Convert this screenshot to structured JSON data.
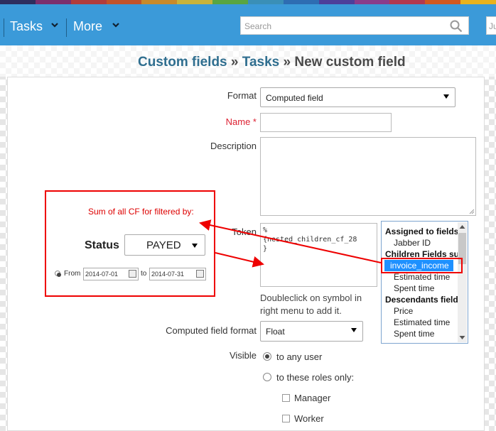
{
  "topstrip": {
    "colors": [
      "#2e2e5e",
      "#7b2f6d",
      "#b13c3c",
      "#c2532a",
      "#c98a2a",
      "#c9b33a",
      "#59a541",
      "#3a8fb7",
      "#2e6db2",
      "#4d3f9a",
      "#8a3c8b",
      "#b2384f",
      "#d2581f",
      "#e8b21e"
    ]
  },
  "navbar": {
    "items": [
      {
        "label": "Tasks"
      },
      {
        "label": "More"
      }
    ],
    "search_placeholder": "Search",
    "extra_text": "Ju"
  },
  "breadcrumb": {
    "part1": "Custom fields",
    "sep1": " » ",
    "part2": "Tasks",
    "sep2": " » ",
    "current": "New custom field"
  },
  "form": {
    "format_label": "Format",
    "format_value": "Computed field",
    "name_label": "Name *",
    "name_value": "",
    "description_label": "Description",
    "description_value": "",
    "token_label": "Token",
    "token_lines": [
      "%",
      "{nested_children_cf_28",
      "}"
    ],
    "hint": "Doubleclick on symbol in right menu to add it.",
    "computed_format_label": "Computed field format",
    "computed_format_value": "Float",
    "visible_label": "Visible",
    "visible_options": [
      "to any user",
      "to these roles only:"
    ],
    "roles": [
      "Manager",
      "Worker"
    ]
  },
  "symbols": [
    {
      "text": "Assigned to fields",
      "kind": "grp"
    },
    {
      "text": "Jabber ID",
      "kind": "sub"
    },
    {
      "text": "Children Fields su",
      "kind": "grp"
    },
    {
      "text": "invoice_income",
      "kind": "sel"
    },
    {
      "text": "Estimated time",
      "kind": "sub"
    },
    {
      "text": "Spent time",
      "kind": "sub"
    },
    {
      "text": "Descendants field",
      "kind": "grp"
    },
    {
      "text": "Price",
      "kind": "sub"
    },
    {
      "text": "Estimated time",
      "kind": "sub"
    },
    {
      "text": "Spent time",
      "kind": "sub"
    }
  ],
  "annotation": {
    "text": "Sum of all CF for filtered by:",
    "status_label": "Status",
    "status_value": "PAYED",
    "from_label": "From",
    "from_value": "2014-07-01",
    "to_label": "to",
    "to_value": "2014-07-31",
    "color": "#e00000"
  }
}
